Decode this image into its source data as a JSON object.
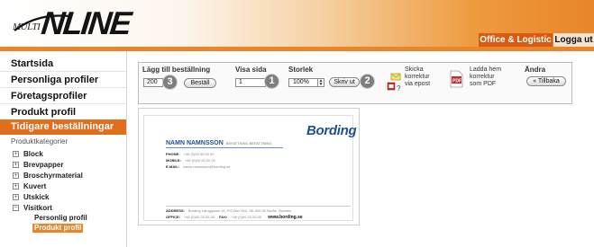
{
  "header": {
    "logo_prefix": "MULTI",
    "logo_text": "NLINE",
    "tabs": [
      {
        "label": "Office & Logistic",
        "active": true
      },
      {
        "label": "Logga ut",
        "active": false
      }
    ],
    "colors": {
      "orange": "#e9852a",
      "tab_active": "#d85a13"
    }
  },
  "sidebar": {
    "nav": [
      {
        "label": "Startsida"
      },
      {
        "label": "Personliga profiler"
      },
      {
        "label": "Företagsprofiler"
      },
      {
        "label": "Produkt profil"
      },
      {
        "label": "Tidigare beställningar",
        "active": true
      }
    ],
    "categories_title": "Produktkategorier",
    "categories": [
      {
        "label": "Block",
        "expanded": false
      },
      {
        "label": "Brevpapper",
        "expanded": false
      },
      {
        "label": "Broschyrmaterial",
        "expanded": false
      },
      {
        "label": "Kuvert",
        "expanded": false
      },
      {
        "label": "Utskick",
        "expanded": false
      },
      {
        "label": "Visitkort",
        "expanded": true
      }
    ],
    "subcategories": [
      {
        "label": "Personlig profil",
        "active": false
      },
      {
        "label": "Produkt profil",
        "active": true
      }
    ]
  },
  "toolbar": {
    "order": {
      "label": "Lägg till beställning",
      "quantity": "200",
      "button": "Beställ"
    },
    "page": {
      "label": "Visa sida",
      "value": "1"
    },
    "size": {
      "label": "Storlek",
      "value": "100%"
    },
    "print_button": "Skriv ut",
    "email": {
      "label_line1": "Skicka",
      "label_line2": "korrektur",
      "label_line3": "via epost"
    },
    "pdf": {
      "label_line1": "Ladda hem",
      "label_line2": "korrektur",
      "label_line3": "som PDF"
    },
    "change": {
      "label": "Ändra",
      "back_button": "« Tillbaka"
    },
    "markers": [
      "1",
      "2",
      "3"
    ],
    "icons": [
      "email-icon",
      "pdf-icon",
      "printer-icon"
    ]
  },
  "preview": {
    "brand": "Bording",
    "name": "NAMN NAMNSSON",
    "title": "BEFATTNING BEFATTNING",
    "lines": [
      {
        "label": "PHONE:",
        "value": "+46 (0)00 00 00 00"
      },
      {
        "label": "MOBILE:",
        "value": "+46 (0)00 00 00 00"
      },
      {
        "label": "E-MAIL:",
        "value": "namn.namnsson@bording.se"
      }
    ],
    "address": {
      "label": "ADDRESS:",
      "value": "Bording Läroggatan 16, P.O Box 000, SE-000 00 Borås, Sweden"
    },
    "office": {
      "label": "OFFICE:",
      "value": "+46 (0)00 00 00 00",
      "fax_label": "FAX:",
      "fax_value": "+46 (0)00 00 00 00",
      "web": "www.bording.se"
    },
    "brand_color": "#1f4f95"
  }
}
